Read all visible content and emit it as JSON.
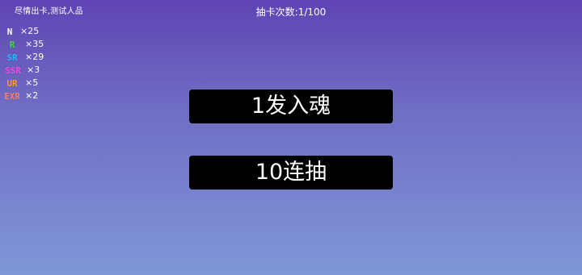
{
  "header": {
    "title": "尽情出卡,测试人品",
    "draw_count_text": "抽卡次数:1/100"
  },
  "rarity_counts": [
    {
      "label": "N",
      "count_text": "×25",
      "color": "#ffffff",
      "icon": "n-rarity-icon"
    },
    {
      "label": "R",
      "count_text": "×35",
      "color": "#3ddc3d",
      "icon": "r-rarity-icon"
    },
    {
      "label": "SR",
      "count_text": "×29",
      "color": "#27b8ff",
      "icon": "sr-rarity-icon"
    },
    {
      "label": "SSR",
      "count_text": "×3",
      "color": "#ff45e9",
      "icon": "ssr-rarity-icon"
    },
    {
      "label": "UR",
      "count_text": "×5",
      "color": "#ff9f1a",
      "icon": "ur-rarity-icon"
    },
    {
      "label": "EXR",
      "count_text": "×2",
      "color": "#ff7d5f",
      "icon": "exr-rarity-icon"
    }
  ],
  "buttons": {
    "single_draw": "1发入魂",
    "ten_draw": "10连抽"
  },
  "theme": {
    "gradient_top": "#5f44b3",
    "gradient_bottom": "#7f98d8",
    "button_color": "#000000"
  }
}
